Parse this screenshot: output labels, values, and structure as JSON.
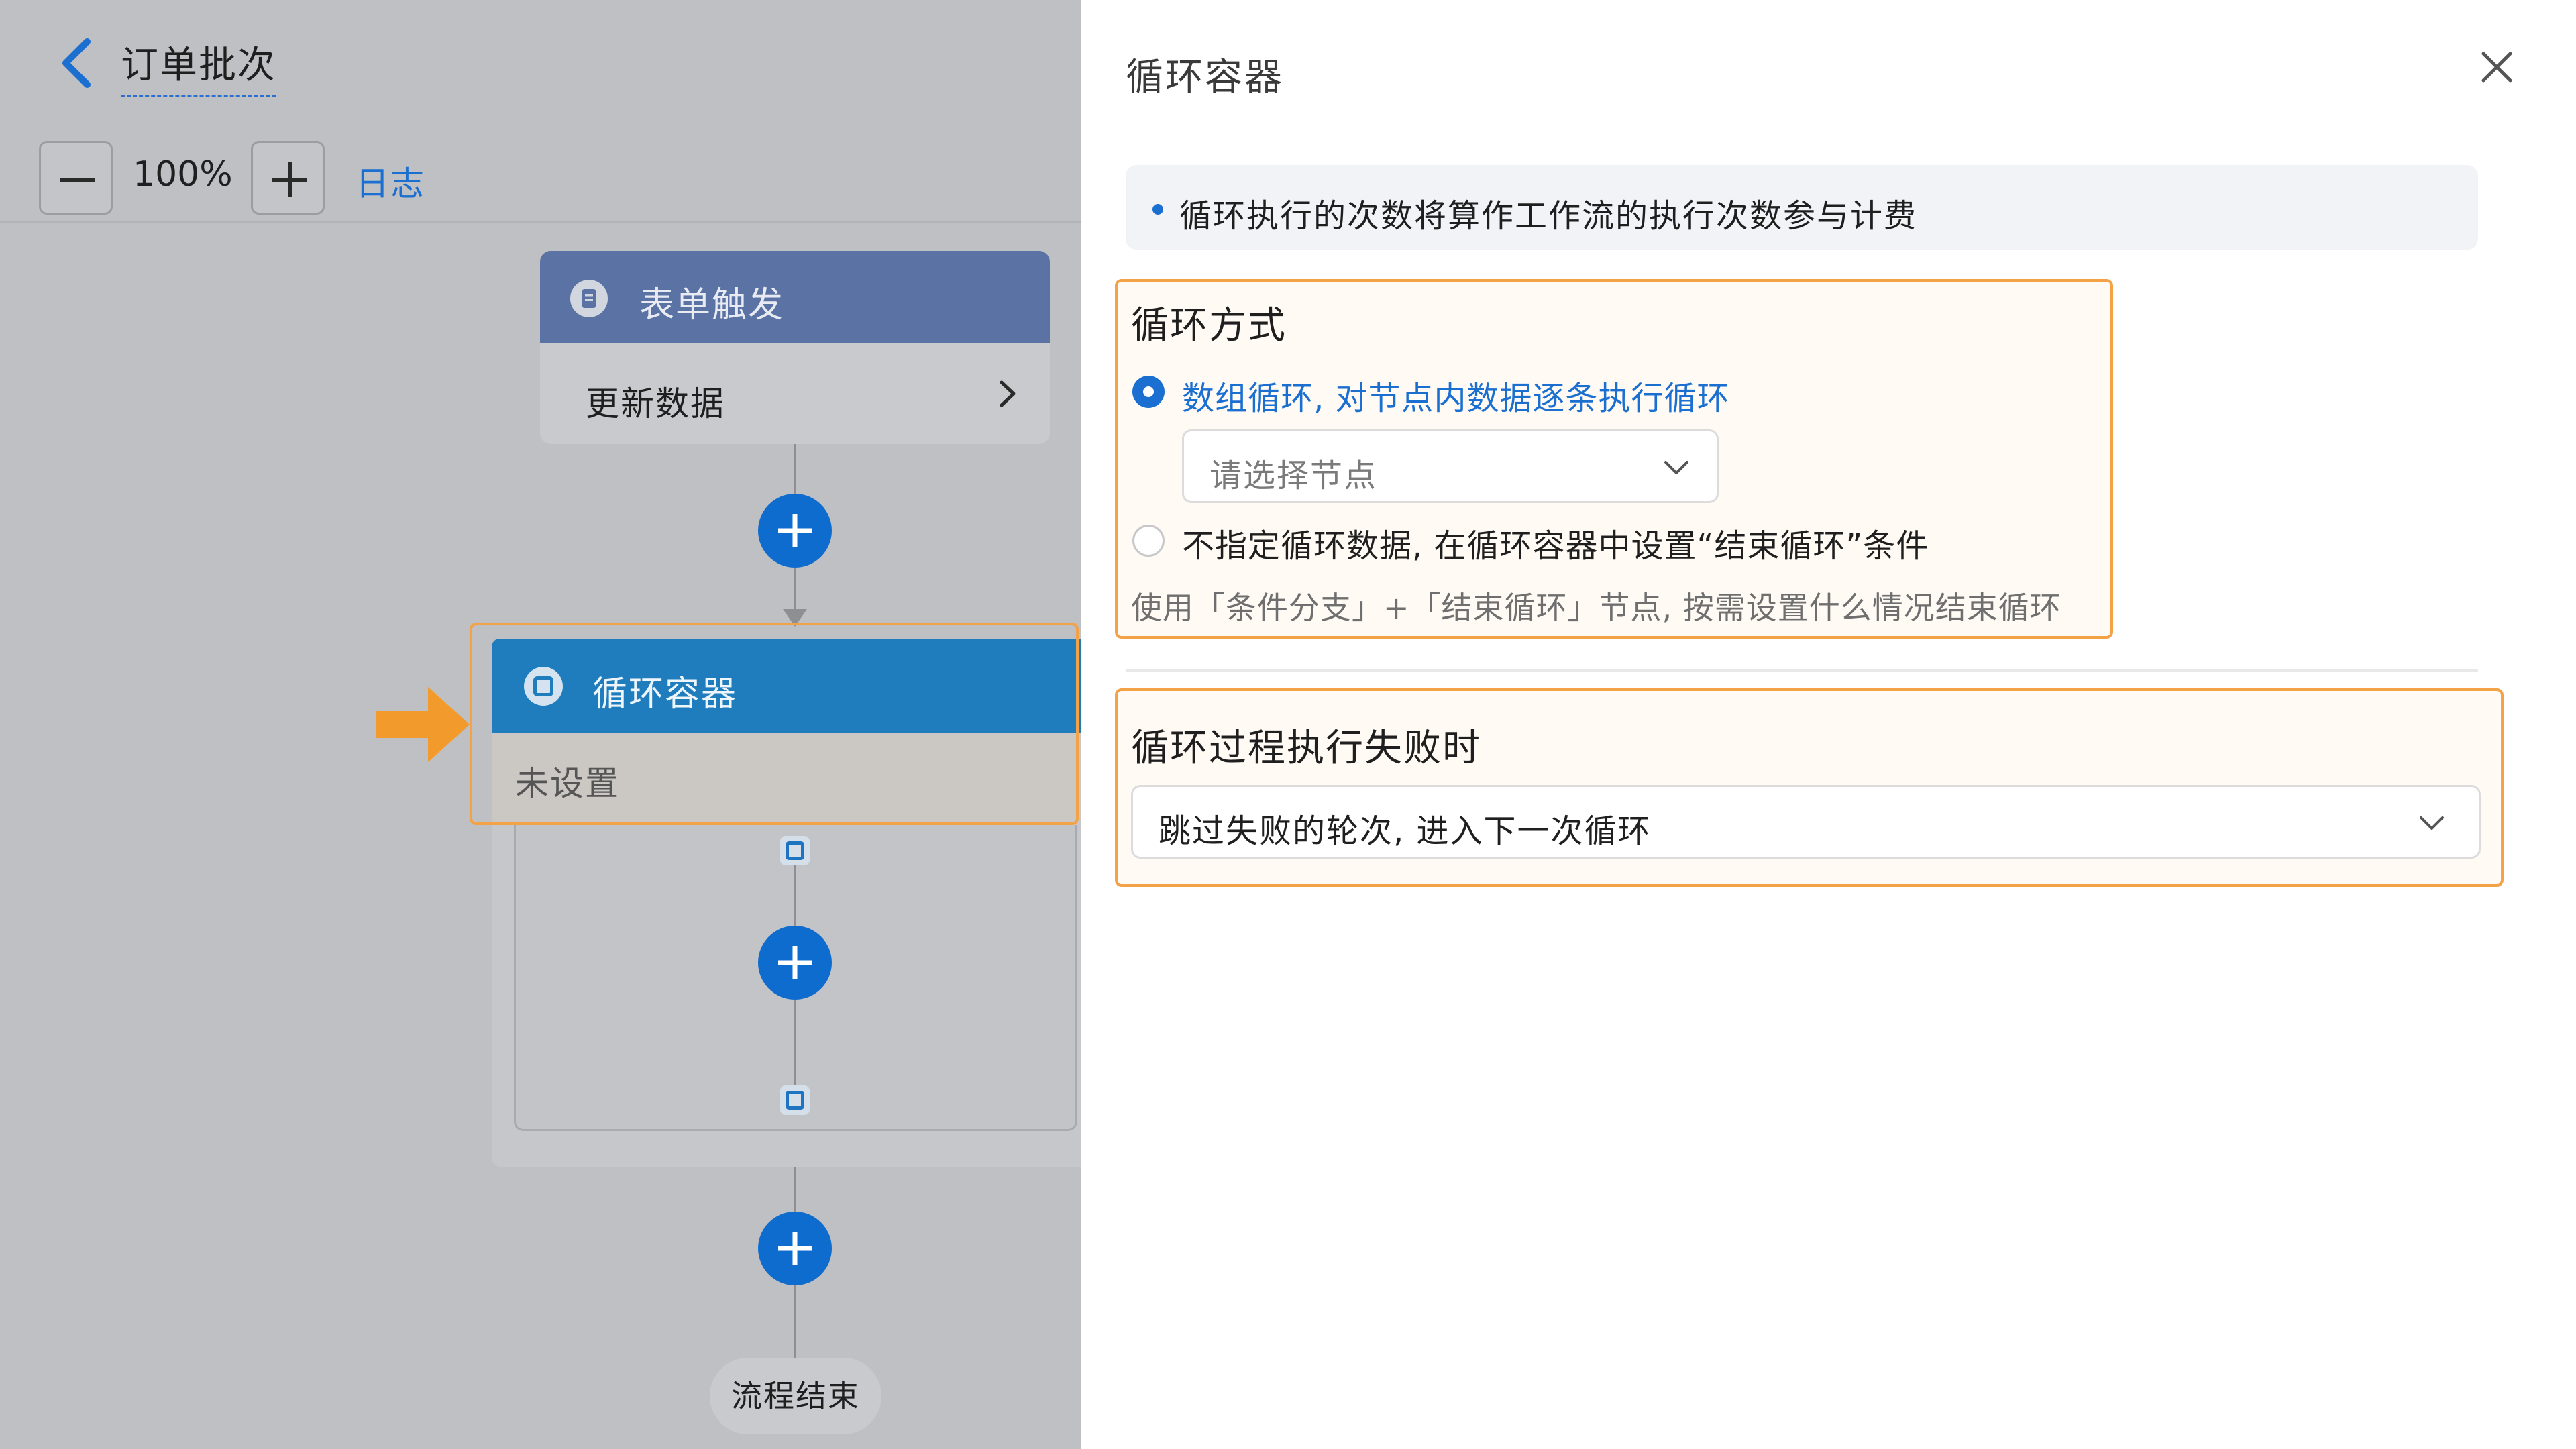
{
  "header": {
    "title": "订单批次",
    "back_icon": "chevron-left-icon"
  },
  "toolbar": {
    "zoom_value": "100%",
    "log_label": "日志"
  },
  "flow": {
    "trigger": {
      "title": "表单触发",
      "detail": "更新数据"
    },
    "loop": {
      "title": "循环容器",
      "status": "未设置"
    },
    "end_label": "流程结束"
  },
  "panel": {
    "title": "循环容器",
    "notice": "循环执行的次数将算作工作流的执行次数参与计费",
    "loop_mode": {
      "title": "循环方式",
      "option_array": "数组循环, 对节点内数据逐条执行循环",
      "node_select_placeholder": "请选择节点",
      "option_none": "不指定循环数据, 在循环容器中设置“结束循环”条件",
      "hint": "使用「条件分支」+「结束循环」节点, 按需设置什么情况结束循环",
      "selected": "option_array"
    },
    "on_failure": {
      "title": "循环过程执行失败时",
      "value": "跳过失败的轮次, 进入下一次循环"
    }
  },
  "colors": {
    "accent": "#1a6fd0",
    "highlight": "#f3a248",
    "loop_header": "#1f7dbd",
    "trigger_header": "#5b72a4"
  }
}
